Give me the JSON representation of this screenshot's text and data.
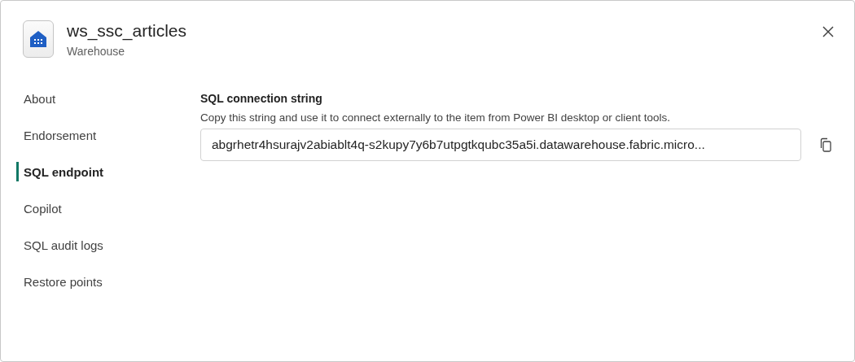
{
  "header": {
    "title": "ws_ssc_articles",
    "subtitle": "Warehouse"
  },
  "sidebar": {
    "items": [
      {
        "label": "About",
        "selected": false
      },
      {
        "label": "Endorsement",
        "selected": false
      },
      {
        "label": "SQL endpoint",
        "selected": true
      },
      {
        "label": "Copilot",
        "selected": false
      },
      {
        "label": "SQL audit logs",
        "selected": false
      },
      {
        "label": "Restore points",
        "selected": false
      }
    ]
  },
  "section": {
    "heading": "SQL connection string",
    "description": "Copy this string and use it to connect externally to the item from Power BI desktop or client tools.",
    "value": "abgrhetr4hsurajv2abiablt4q-s2kupy7y6b7utpgtkqubc35a5i.datawarehouse.fabric.micro..."
  }
}
